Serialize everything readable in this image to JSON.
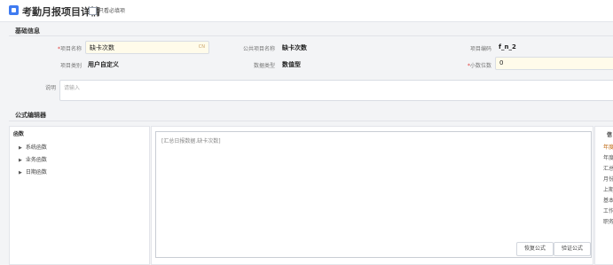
{
  "header": {
    "title": "考勤月报项目详情",
    "only_required_label": "只看必填项"
  },
  "basic_info": {
    "section_title": "基础信息",
    "item_name_label": "项目名称",
    "item_name_value": "缺卡次数",
    "item_name_lang": "CN",
    "public_name_label": "公共项目名称",
    "public_name_value": "缺卡次数",
    "item_code_label": "项目编码",
    "item_code_value": "f_n_2",
    "item_category_label": "项目类别",
    "item_category_value": "用户自定义",
    "data_type_label": "数据类型",
    "data_type_value": "数值型",
    "decimal_label": "小数位数",
    "decimal_value": "0",
    "desc_label": "说明",
    "desc_placeholder": "请输入"
  },
  "formula": {
    "section_title": "公式编辑器",
    "func_header": "函数",
    "func_items": [
      "系统函数",
      "业务函数",
      "日期函数"
    ],
    "editor_text": "[汇总日报数据.缺卡次数]",
    "restore_button": "恢复公式",
    "validate_button": "验证公式"
  },
  "info_panel": {
    "header": "信",
    "items": [
      "年度",
      "年度",
      "汇总",
      "月份",
      "上期",
      "基本",
      "工作",
      "职务"
    ]
  },
  "colors": {
    "accent": "#3f7bf1",
    "required": "#e03b3b",
    "input_yellow": "#fffbea"
  }
}
